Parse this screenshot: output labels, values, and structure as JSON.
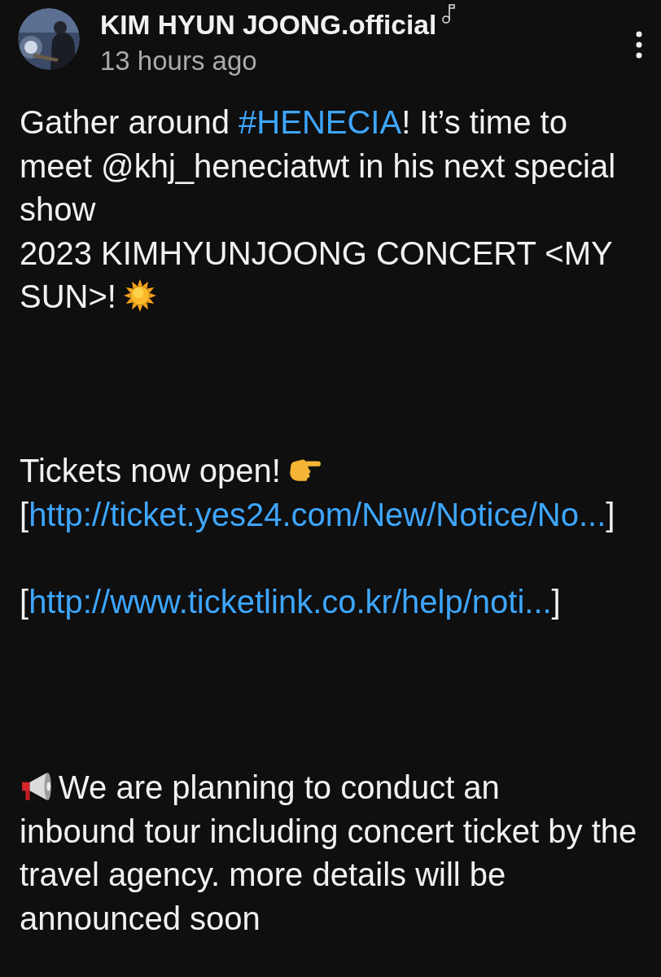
{
  "post": {
    "channel_name": "KIM HYUN JOONG.official",
    "time": "13 hours ago"
  },
  "body": [
    {
      "kind": "text",
      "parts": [
        {
          "text": "Gather around ",
          "kind": "plain"
        },
        {
          "text": "#HENECIA",
          "kind": "hashtag"
        },
        {
          "text": "! It’s time to meet @khj_heneciatwt in his next special show",
          "kind": "plain"
        }
      ]
    },
    {
      "kind": "text",
      "parts": [
        {
          "text": "2023 KIMHYUNJOONG CONCERT <MY",
          "kind": "plain"
        }
      ]
    },
    {
      "kind": "text",
      "parts": [
        {
          "text": "SUN>!",
          "kind": "plain"
        },
        {
          "kind": "sun-emoji"
        }
      ]
    },
    {
      "kind": "break"
    },
    {
      "kind": "break"
    },
    {
      "kind": "break"
    },
    {
      "kind": "text",
      "parts": [
        {
          "text": "Tickets now open!",
          "kind": "plain"
        },
        {
          "kind": "pointing-hand-emoji"
        }
      ]
    },
    {
      "kind": "link",
      "open": "[",
      "url": "http://ticket.yes24.com/New/Notice/No...",
      "close": "]"
    },
    {
      "kind": "break"
    },
    {
      "kind": "link",
      "open": "[",
      "url": "http://www.ticketlink.co.kr/help/noti...",
      "close": "]"
    },
    {
      "kind": "break"
    },
    {
      "kind": "break"
    },
    {
      "kind": "break"
    },
    {
      "kind": "text",
      "parts": [
        {
          "kind": "megaphone-emoji"
        },
        {
          "text": "We are planning to conduct an",
          "kind": "plain"
        }
      ]
    },
    {
      "kind": "text",
      "parts": [
        {
          "text": "inbound tour including concert ticket by the travel agency. more details will be announced soon",
          "kind": "plain"
        }
      ]
    }
  ]
}
